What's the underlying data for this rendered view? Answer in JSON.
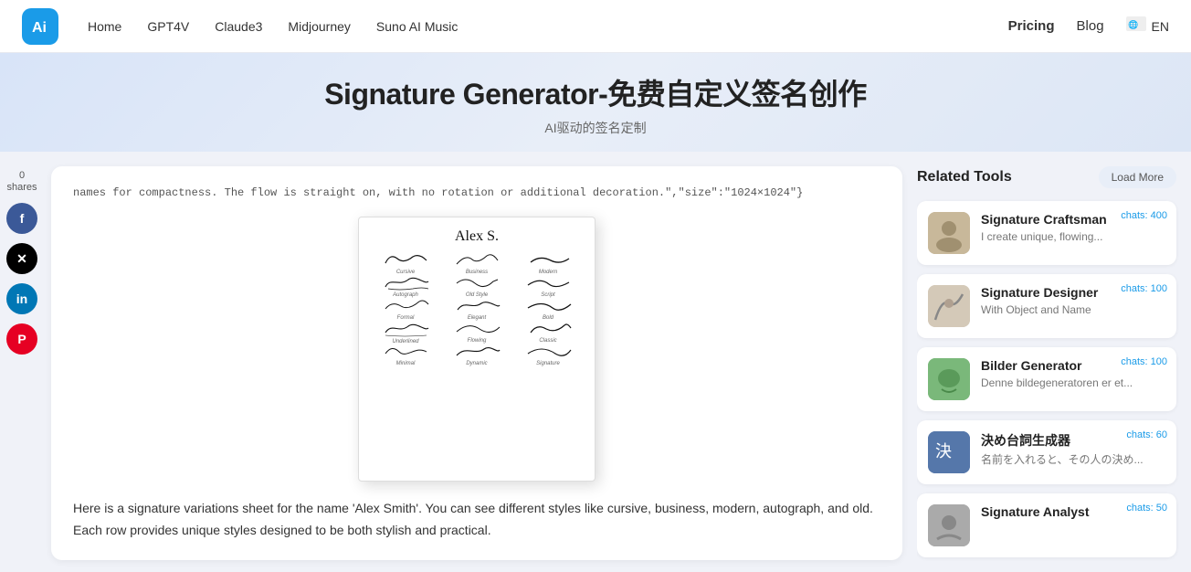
{
  "navbar": {
    "logo_text": "Ai",
    "links": [
      {
        "label": "Home",
        "id": "home"
      },
      {
        "label": "GPT4V",
        "id": "gpt4v"
      },
      {
        "label": "Claude3",
        "id": "claude3"
      },
      {
        "label": "Midjourney",
        "id": "midjourney"
      },
      {
        "label": "Suno AI Music",
        "id": "suno"
      }
    ],
    "pricing_label": "Pricing",
    "blog_label": "Blog",
    "lang_label": "EN"
  },
  "hero": {
    "title": "Signature Generator-免费自定义签名创作",
    "subtitle": "AI驱动的签名定制"
  },
  "social": {
    "count": "0",
    "shares_label": "shares"
  },
  "content": {
    "code_text": "names for compactness. The flow is straight on, with no rotation or additional decoration.\",\"size\":\"1024×1024\"}",
    "description": "Here is a signature variations sheet for the name 'Alex Smith'. You can see different styles like cursive, business, modern, autograph, and old. Each row provides unique styles designed to be both stylish and practical."
  },
  "related_tools": {
    "title": "Related Tools",
    "load_more_label": "Load More",
    "tools": [
      {
        "name": "Signature Craftsman",
        "desc": "I create unique, flowing...",
        "chats": "chats: 400",
        "color": "#c8b89a"
      },
      {
        "name": "Signature Designer",
        "desc": "With Object and Name",
        "chats": "chats: 100",
        "color": "#d4c9b8"
      },
      {
        "name": "Bilder Generator",
        "desc": "Denne bildegeneratoren er et...",
        "chats": "chats: 100",
        "color": "#7ab87a"
      },
      {
        "name": "決め台詞生成器",
        "desc": "名前を入れると、その人の決め...",
        "chats": "chats: 60",
        "color": "#5577aa"
      },
      {
        "name": "Signature Analyst",
        "desc": "",
        "chats": "chats: 50",
        "color": "#aaaaaa"
      }
    ]
  }
}
